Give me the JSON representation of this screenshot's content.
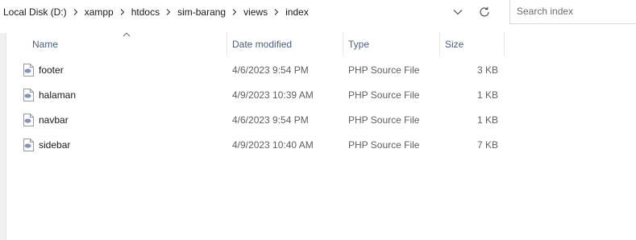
{
  "breadcrumb": {
    "items": [
      "Local Disk (D:)",
      "xampp",
      "htdocs",
      "sim-barang",
      "views",
      "index"
    ]
  },
  "search": {
    "placeholder": "Search index"
  },
  "columns": {
    "name": "Name",
    "date_modified": "Date modified",
    "type": "Type",
    "size": "Size",
    "sort_icon": "sort-ascending-icon"
  },
  "files": [
    {
      "name": "footer",
      "date_modified": "4/6/2023 9:54 PM",
      "type": "PHP Source File",
      "size": "3 KB",
      "icon": "php-file-icon"
    },
    {
      "name": "halaman",
      "date_modified": "4/9/2023 10:39 AM",
      "type": "PHP Source File",
      "size": "1 KB",
      "icon": "php-file-icon"
    },
    {
      "name": "navbar",
      "date_modified": "4/6/2023 9:54 PM",
      "type": "PHP Source File",
      "size": "1 KB",
      "icon": "php-file-icon"
    },
    {
      "name": "sidebar",
      "date_modified": "4/9/2023 10:40 AM",
      "type": "PHP Source File",
      "size": "7 KB",
      "icon": "php-file-icon"
    }
  ],
  "colors": {
    "header_text": "#4c607a",
    "php_icon": "#8892bf",
    "secondary_text": "#5f5f5f"
  }
}
